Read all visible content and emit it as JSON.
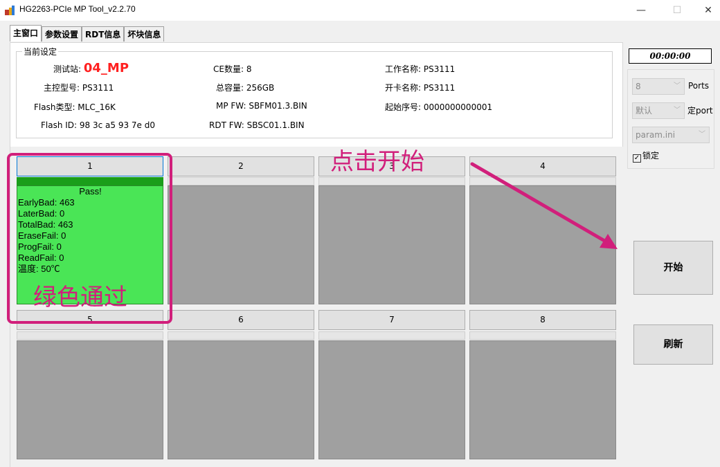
{
  "window": {
    "title": "HG2263-PCIe MP Tool_v2.2.70",
    "minimize": "—",
    "maximize": "☐",
    "close": "✕"
  },
  "tabs": [
    "主窗口",
    "参数设置",
    "RDT信息",
    "坏块信息"
  ],
  "settings": {
    "group_title": "当前设定",
    "station_label": "测试站:",
    "station_value": "04_MP",
    "controller": "主控型号: PS3111",
    "flash_type": "Flash类型: MLC_16K",
    "flash_id": "Flash ID: 98 3c a5 93 7e d0",
    "ce_count": "CE数量: 8",
    "capacity": "总容量: 256GB",
    "mp_fw": "MP FW: SBFM01.3.BIN",
    "rdt_fw": "RDT FW: SBSC01.1.BIN",
    "work_name": "工作名称: PS3111",
    "open_card_name": "开卡名称: PS3111",
    "start_serial": "起始序号: 0000000000001"
  },
  "ports": [
    {
      "label": "1",
      "status": "pass",
      "lines": [
        "Pass!",
        "EarlyBad: 463",
        "LaterBad: 0",
        "TotalBad: 463",
        "EraseFail: 0",
        "ProgFail: 0",
        "ReadFail: 0",
        "温度: 50℃"
      ]
    },
    {
      "label": "2",
      "status": "idle"
    },
    {
      "label": "3",
      "status": "idle"
    },
    {
      "label": "4",
      "status": "idle"
    },
    {
      "label": "5",
      "status": "idle"
    },
    {
      "label": "6",
      "status": "idle"
    },
    {
      "label": "7",
      "status": "idle"
    },
    {
      "label": "8",
      "status": "idle"
    }
  ],
  "side": {
    "timer": "00:00:00",
    "ports_value": "8",
    "ports_label": "Ports",
    "default_value": "默认",
    "fixed_port_label": "定port",
    "param_file": "param.ini",
    "lock_label": "锁定",
    "start_button": "开始",
    "refresh_button": "刷新"
  },
  "annotations": {
    "click_start": "点击开始",
    "green_pass": "绿色通过"
  },
  "colors": {
    "pass_green": "#4ae556",
    "progress_green": "#1a9e1a",
    "annotation": "#d11f7b",
    "station_red": "#ff2020"
  }
}
